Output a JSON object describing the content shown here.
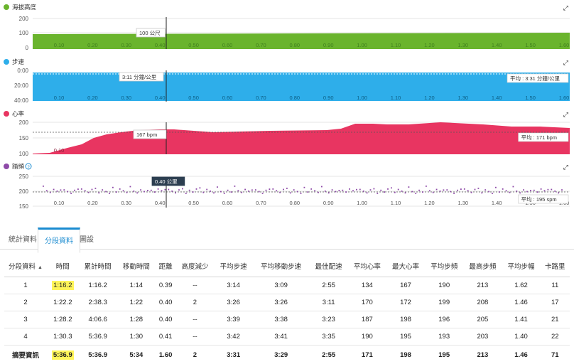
{
  "colors": {
    "elevation": "#6ab42d",
    "pace": "#2eaeea",
    "heart_rate": "#e83561",
    "cadence": "#8e4aa8",
    "tab_accent": "#1a8bd0",
    "highlight": "#fff55a"
  },
  "charts": {
    "ticks": [
      "0.10",
      "0.20",
      "0.30",
      "0.40",
      "0.50",
      "0.60",
      "0.70",
      "0.80",
      "0.90",
      "1.00",
      "1.10",
      "1.20",
      "1.30",
      "1.40",
      "1.50",
      "1.60"
    ],
    "elevation": {
      "title": "海拔高度",
      "y_ticks": [
        "200",
        "100",
        "0"
      ],
      "hover_label": "100 公尺"
    },
    "pace": {
      "title": "步速",
      "y_ticks": [
        "0:00",
        "20:00",
        "40:00"
      ],
      "hover_label": "3:11 分鐘/公里",
      "avg_label": "平均 : 3:31 分鐘/公里"
    },
    "heart_rate": {
      "title": "心率",
      "y_ticks": [
        "200",
        "150",
        "100"
      ],
      "hover_label": "167 bpm",
      "avg_label": "平均 : 171 bpm"
    },
    "cadence": {
      "title": "踏頻",
      "y_ticks": [
        "250",
        "200",
        "150"
      ],
      "hover_label": "0.40 公里",
      "avg_label": "平均 : 195 spm"
    }
  },
  "tabs": [
    {
      "label": "統計資料"
    },
    {
      "label": "分段資料"
    },
    {
      "label": "圖設"
    }
  ],
  "table": {
    "headers": [
      "分段資料",
      "時間",
      "累計時間",
      "移動時間",
      "距離",
      "高度減少",
      "平均步速",
      "平均移動步速",
      "最佳配速",
      "平均心率",
      "最大心率",
      "平均步頻",
      "最高步頻",
      "平均步幅",
      "卡路里"
    ],
    "rows": [
      [
        "1",
        "1:16.2",
        "1:16.2",
        "1:14",
        "0.39",
        "--",
        "3:14",
        "3:09",
        "2:55",
        "134",
        "167",
        "190",
        "213",
        "1.62",
        "11"
      ],
      [
        "2",
        "1:22.2",
        "2:38.3",
        "1:22",
        "0.40",
        "2",
        "3:26",
        "3:26",
        "3:11",
        "170",
        "172",
        "199",
        "208",
        "1.46",
        "17"
      ],
      [
        "3",
        "1:28.2",
        "4:06.6",
        "1:28",
        "0.40",
        "--",
        "3:39",
        "3:38",
        "3:23",
        "187",
        "198",
        "196",
        "205",
        "1.41",
        "21"
      ],
      [
        "4",
        "1:30.3",
        "5:36.9",
        "1:30",
        "0.41",
        "--",
        "3:42",
        "3:41",
        "3:35",
        "190",
        "195",
        "193",
        "203",
        "1.40",
        "22"
      ]
    ],
    "summary": [
      "摘要資訊",
      "5:36.9",
      "5:36.9",
      "5:34",
      "1.60",
      "2",
      "3:31",
      "3:29",
      "2:55",
      "171",
      "198",
      "195",
      "213",
      "1.46",
      "71"
    ]
  }
}
